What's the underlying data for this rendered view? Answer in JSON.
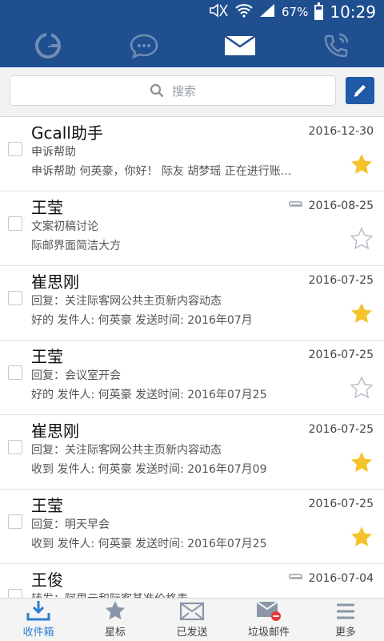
{
  "status_bar": {
    "battery_text": "67%",
    "battery_level": 0.67,
    "time": "10:29",
    "icons": [
      "mute-icon",
      "wifi-icon",
      "signal-icon",
      "battery-icon"
    ]
  },
  "top_nav": {
    "tabs": [
      {
        "name": "gcall-logo-icon",
        "active": false
      },
      {
        "name": "chat-icon",
        "active": false
      },
      {
        "name": "mail-icon",
        "active": true
      },
      {
        "name": "phone-icon",
        "active": false
      }
    ]
  },
  "search": {
    "placeholder": "搜索"
  },
  "colors": {
    "primary": "#1f4f8f",
    "compose": "#1f5aa6",
    "star_filled": "#f4c22b",
    "active_tab": "#2a7fd4"
  },
  "emails": [
    {
      "sender": "Gcall助手",
      "date": "2016-12-30",
      "subject": "申诉帮助",
      "preview": "申诉帮助 何英豪，你好！ 际友 胡梦瑶 正在进行账...",
      "starred": true,
      "attachment": false
    },
    {
      "sender": "王莹",
      "date": "2016-08-25",
      "subject": "文案初稿讨论",
      "preview": "际邮界面简洁大方",
      "starred": false,
      "attachment": true
    },
    {
      "sender": "崔思刚",
      "date": "2016-07-25",
      "subject": "回复：关注际客网公共主页新内容动态",
      "preview": "好的 发件人: 何英豪 发送时间: 2016年07月",
      "starred": true,
      "attachment": false
    },
    {
      "sender": "王莹",
      "date": "2016-07-25",
      "subject": "回复：会议室开会",
      "preview": "好的 发件人: 何英豪 发送时间: 2016年07月25",
      "starred": false,
      "attachment": false
    },
    {
      "sender": "崔思刚",
      "date": "2016-07-25",
      "subject": "回复：关注际客网公共主页新内容动态",
      "preview": "收到 发件人: 何英豪 发送时间: 2016年07月09",
      "starred": true,
      "attachment": false
    },
    {
      "sender": "王莹",
      "date": "2016-07-25",
      "subject": "回复：明天早会",
      "preview": "收到 发件人: 何英豪 发送时间: 2016年07月25",
      "starred": true,
      "attachment": false
    },
    {
      "sender": "王俊",
      "date": "2016-07-04",
      "subject": "转发：阿里云和际客基准价格表",
      "preview": "",
      "starred": false,
      "attachment": true
    }
  ],
  "bottom_bar": {
    "items": [
      {
        "label": "收件箱",
        "icon": "inbox-icon",
        "active": true
      },
      {
        "label": "星标",
        "icon": "star-icon",
        "active": false
      },
      {
        "label": "已发送",
        "icon": "sent-icon",
        "active": false
      },
      {
        "label": "垃圾邮件",
        "icon": "spam-icon",
        "active": false
      },
      {
        "label": "更多",
        "icon": "menu-icon",
        "active": false
      }
    ]
  }
}
